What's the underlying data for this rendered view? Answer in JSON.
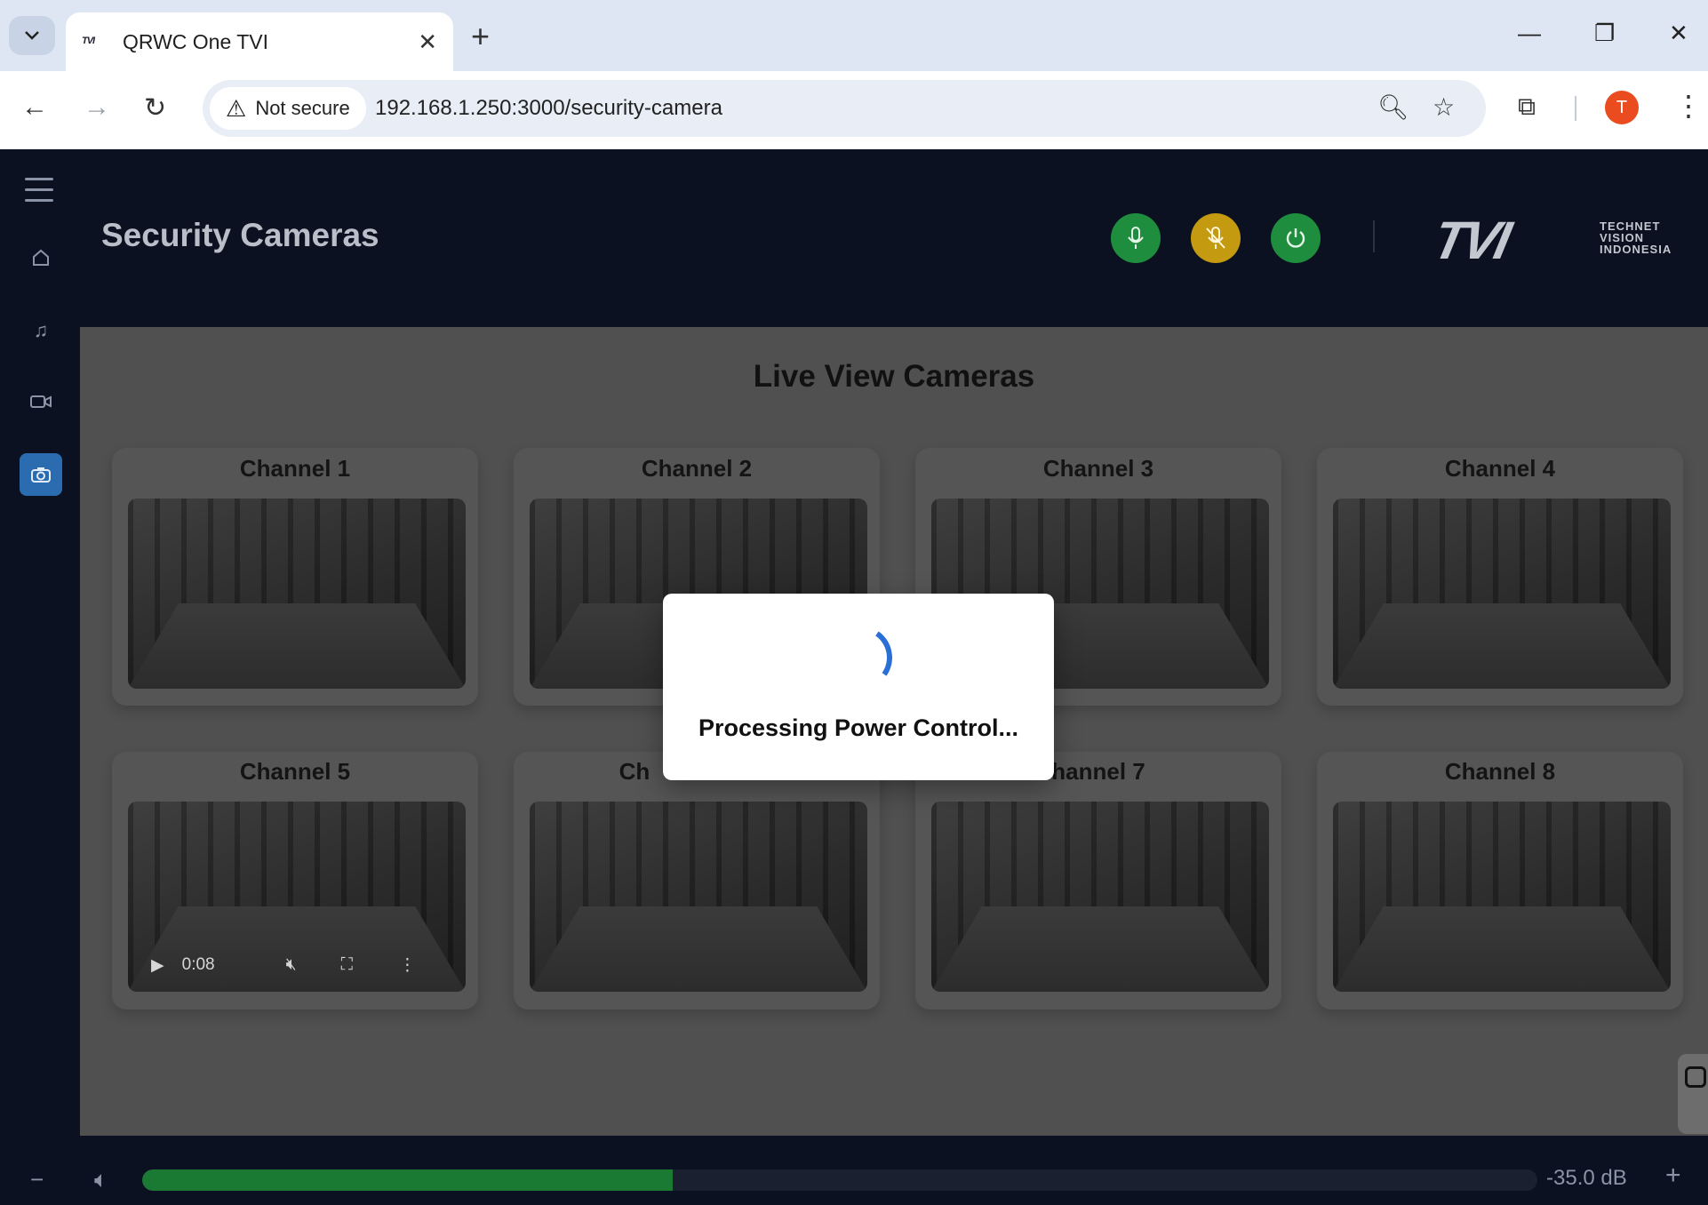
{
  "browser": {
    "tab_title": "QRWC One TVI",
    "favicon_text": "TVI",
    "security_label": "Not secure",
    "url": "192.168.1.250:3000/security-camera",
    "profile_initial": "T"
  },
  "sidebar": {
    "items": [
      {
        "name": "home",
        "icon": "home-icon"
      },
      {
        "name": "audio",
        "icon": "music-note-icon"
      },
      {
        "name": "video",
        "icon": "video-camera-icon"
      },
      {
        "name": "security-camera",
        "icon": "camera-icon",
        "active": true
      }
    ]
  },
  "header": {
    "title": "Security Cameras",
    "buttons": [
      {
        "name": "mic-button",
        "icon": "microphone-icon",
        "color": "#1e8e3e"
      },
      {
        "name": "mic-mute-button",
        "icon": "microphone-off-icon",
        "color": "#c49a10"
      },
      {
        "name": "power-button",
        "icon": "power-icon",
        "color": "#1e8e3e"
      }
    ],
    "logo": {
      "mark": "TVI",
      "line1": "TECHNET",
      "line2": "VISION",
      "line3": "INDONESIA"
    }
  },
  "main": {
    "section_title": "Live View Cameras",
    "channels": [
      {
        "label": "Channel 1"
      },
      {
        "label": "Channel 2"
      },
      {
        "label": "Channel 3"
      },
      {
        "label": "Channel 4"
      },
      {
        "label": "Channel 5",
        "time": "0:08"
      },
      {
        "label": "Ch"
      },
      {
        "label": "hannel 7"
      },
      {
        "label": "Channel 8"
      }
    ]
  },
  "modal": {
    "message": "Processing Power Control..."
  },
  "volume": {
    "value_label": "-35.0 dB",
    "level_percent": 38
  },
  "colors": {
    "accent_blue": "#2b6cb0",
    "green": "#1e8e3e",
    "amber": "#c49a10",
    "browser_profile": "#ea4b1f"
  }
}
